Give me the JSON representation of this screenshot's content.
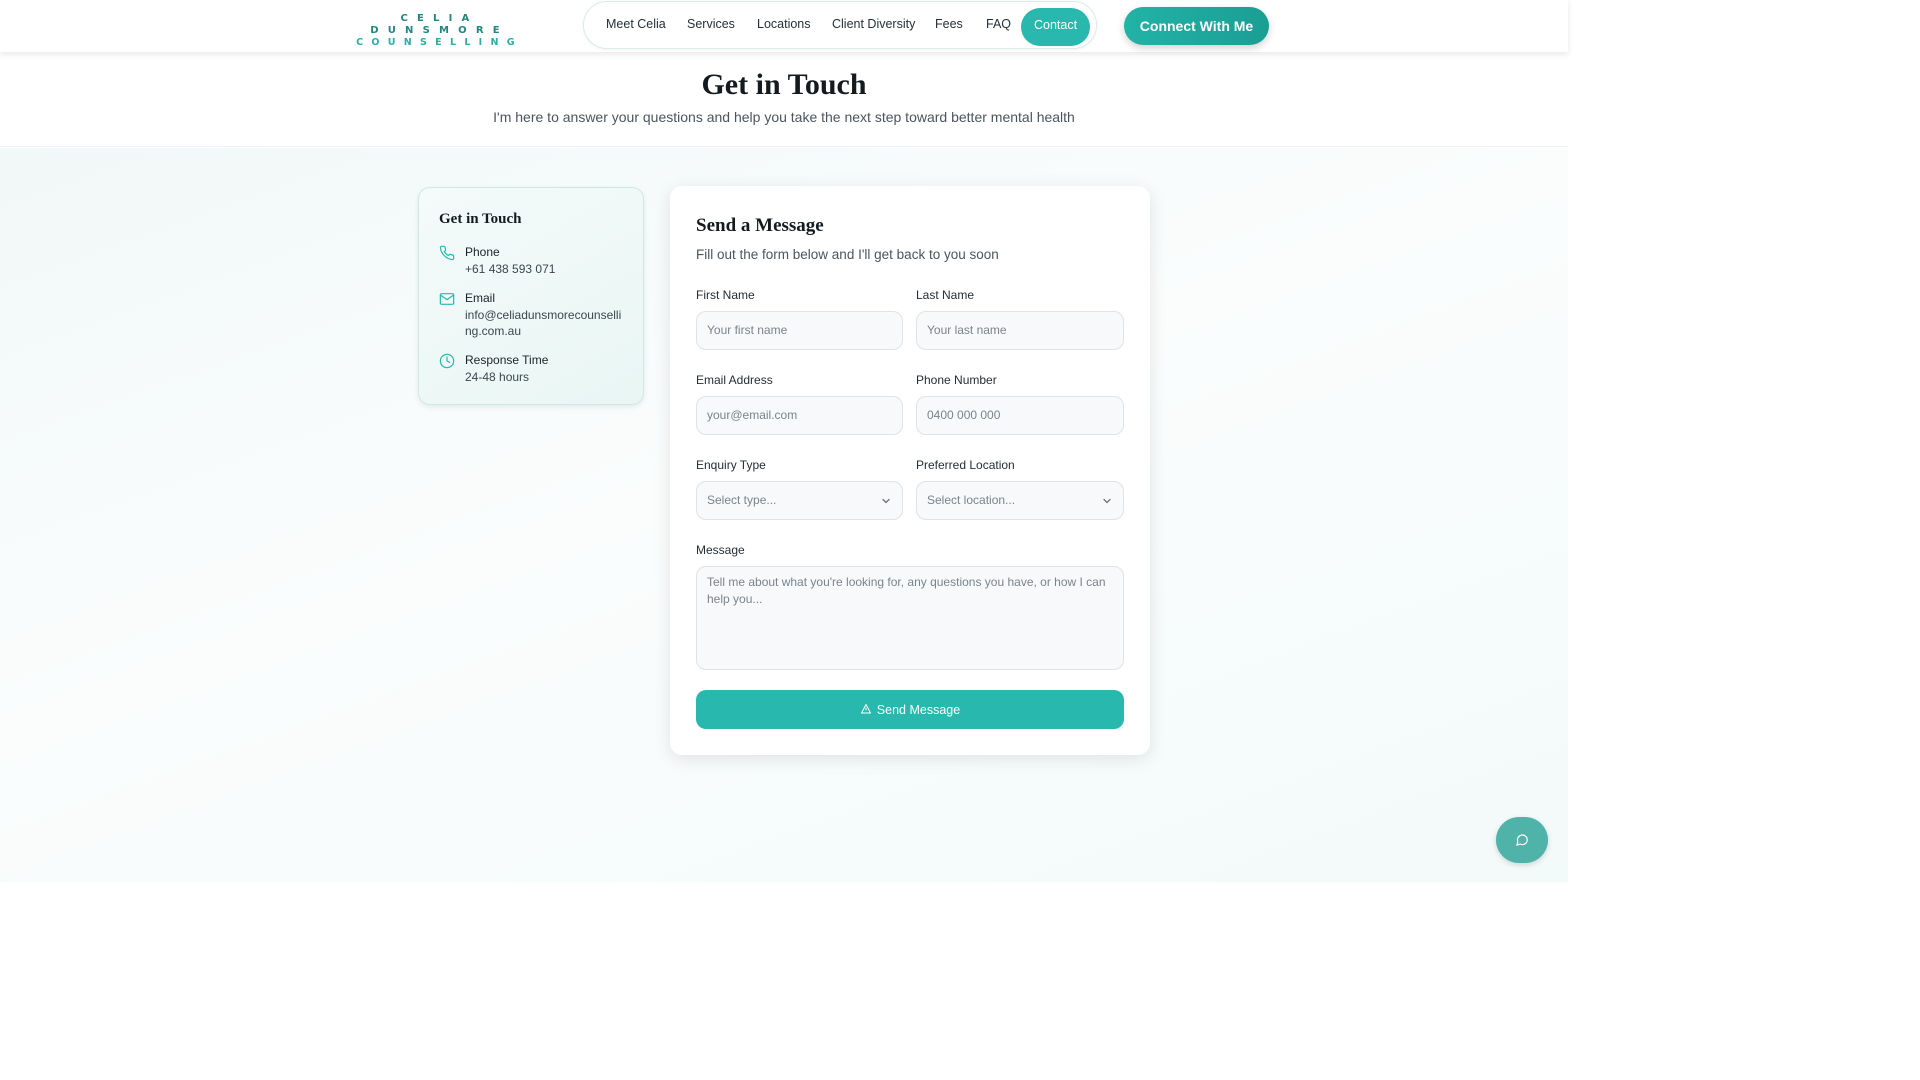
{
  "brand": {
    "line1": "CELIA DUNSMORE",
    "line2": "COUNSELLING",
    "accent": "#28b8ad"
  },
  "nav": {
    "items": [
      {
        "label": "Meet Celia"
      },
      {
        "label": "Services"
      },
      {
        "label": "Locations"
      },
      {
        "label": "Client Diversity"
      },
      {
        "label": "Fees"
      },
      {
        "label": "FAQ"
      },
      {
        "label": "Contact",
        "active": true
      }
    ],
    "cta_label": "Connect With Me"
  },
  "hero": {
    "title": "Get in Touch",
    "subtitle": "I'm here to answer your questions and help you take the next step toward better mental health"
  },
  "contact_card": {
    "title": "Get in Touch",
    "items": [
      {
        "icon": "phone-icon",
        "label": "Phone",
        "value": "+61 438 593 071"
      },
      {
        "icon": "mail-icon",
        "label": "Email",
        "value": "info@celiadunsmorecounselling.com.au"
      },
      {
        "icon": "clock-icon",
        "label": "Response Time",
        "value": "24-48 hours"
      }
    ]
  },
  "form": {
    "title": "Send a Message",
    "subtitle": "Fill out the form below and I'll get back to you soon",
    "first_name": {
      "label": "First Name",
      "placeholder": "Your first name",
      "value": ""
    },
    "last_name": {
      "label": "Last Name",
      "placeholder": "Your last name",
      "value": ""
    },
    "email": {
      "label": "Email Address",
      "placeholder": "your@email.com",
      "value": ""
    },
    "phone": {
      "label": "Phone Number",
      "placeholder": "0400 000 000",
      "value": ""
    },
    "enquiry_type": {
      "label": "Enquiry Type",
      "selected": "Select type..."
    },
    "location": {
      "label": "Preferred Location",
      "selected": "Select location..."
    },
    "message": {
      "label": "Message",
      "placeholder": "Tell me about what you're looking for, any questions you have, or how I can help you..."
    },
    "submit_label": "Send Message"
  },
  "chat": {
    "icon": "chat-bubble-icon"
  }
}
